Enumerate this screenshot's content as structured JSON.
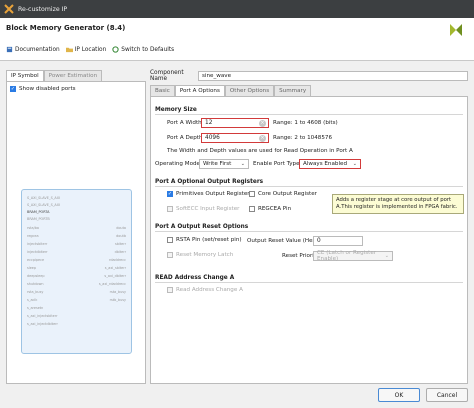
{
  "window": {
    "title": "Re-customize IP"
  },
  "header": {
    "ip_title": "Block Memory Generator (8.4)",
    "toolbar": {
      "documentation": "Documentation",
      "ip_location": "IP Location",
      "switch_defaults": "Switch to Defaults"
    }
  },
  "left": {
    "tabs": [
      "IP Symbol",
      "Power Estimation"
    ],
    "show_disabled_ports": "Show disabled ports",
    "pins_left": [
      "S_AXI_SLAVE_S_AXI",
      "S_AXI_SLAVE_S_AXI",
      "BRAM_PORTA",
      "BRAM_PORTB",
      "rsta/ba",
      "regcea",
      "injectsbiterr",
      "injectdbiterr",
      "eccpipece",
      "sleep",
      "deepsleep",
      "shutdown",
      "rsta_busy",
      "s_aclk",
      "s_aresetn",
      "s_axi_injectsbiterr",
      "s_axi_injectdbiterr"
    ],
    "pins_right": [
      "douta",
      "doutb",
      "sbiterr",
      "dbiterr",
      "rdaddrecc",
      "s_axi_sbiterr",
      "s_axi_dbiterr",
      "s_axi_rdaddrecc",
      "rsta_busy",
      "rstb_busy"
    ]
  },
  "right": {
    "component_label": "Component Name",
    "component_value": "sine_wave",
    "tabs": [
      "Basic",
      "Port A Options",
      "Other Options",
      "Summary"
    ],
    "memory_size": {
      "title": "Memory Size",
      "width_label": "Port A Width",
      "width_value": "12",
      "width_range": "Range: 1 to 4608 (bits)",
      "depth_label": "Port A Depth",
      "depth_value": "4096",
      "depth_range": "Range: 2 to 1048576",
      "note": "The Width and Depth values are used for Read Operation in Port A",
      "op_mode_label": "Operating Mode",
      "op_mode_value": "Write First",
      "enable_label": "Enable Port Type",
      "enable_value": "Always Enabled"
    },
    "output_regs": {
      "title": "Port A Optional Output Registers",
      "primitives": "Primitives Output Register",
      "core": "Core Output Register",
      "softecc": "SoftECC Input Register",
      "regcea": "REGCEA Pin"
    },
    "tooltip": "Adds a register stage at core output of port A.This register is implemented in FPGA fabric.",
    "reset": {
      "title": "Port A Output Reset Options",
      "rsta_pin": "RSTA Pin (set/reset pin)",
      "reset_value_label": "Output Reset Value (Hex)",
      "reset_value": "0",
      "reset_latch": "Reset Memory Latch",
      "priority_label": "Reset Priority",
      "priority_value": "CE (Latch or Register Enable)"
    },
    "read_address": {
      "title": "READ Address Change A",
      "read_change": "Read Address Change A"
    }
  },
  "footer": {
    "ok": "OK",
    "cancel": "Cancel"
  },
  "colors": {
    "accent": "#2a7be4",
    "highlight": "#d23a3a",
    "titlebar": "#3c3f41",
    "tooltip_bg": "#fcfcd4"
  }
}
